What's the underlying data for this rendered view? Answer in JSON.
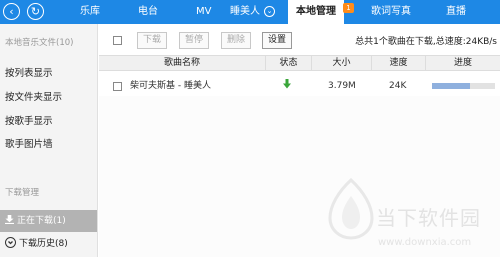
{
  "topbar": {
    "tabs": [
      {
        "label": "乐库"
      },
      {
        "label": "电台"
      },
      {
        "label": "MV"
      },
      {
        "label": "睡美人"
      },
      {
        "label": "本地管理",
        "badge": "1"
      },
      {
        "label": "歌词写真"
      },
      {
        "label": "直播"
      }
    ],
    "accent_color": "#1e88e5",
    "badge_color": "#ff8c1a"
  },
  "sidebar": {
    "section_local": "本地音乐文件(10)",
    "items": [
      {
        "label": "按列表显示"
      },
      {
        "label": "按文件夹显示"
      },
      {
        "label": "按歌手显示"
      },
      {
        "label": "歌手图片墙"
      }
    ],
    "section_download": "下载管理",
    "downloading": "正在下载(1)",
    "history": "下载历史(8)"
  },
  "toolbar": {
    "download_label": "下载",
    "pause_label": "暂停",
    "delete_label": "删除",
    "settings_label": "设置",
    "status_text": "总共1个歌曲在下载,总速度:24KB/s"
  },
  "table": {
    "columns": [
      "歌曲名称",
      "状态",
      "大小",
      "速度",
      "进度"
    ],
    "rows": [
      {
        "name": "柴可夫斯基 - 睡美人",
        "status_icon": "download-arrow-icon",
        "size": "3.79M",
        "speed": "24K",
        "progress": 0.6
      }
    ]
  },
  "watermark": {
    "title": "当下软件园",
    "url": "www.downxia.com"
  }
}
